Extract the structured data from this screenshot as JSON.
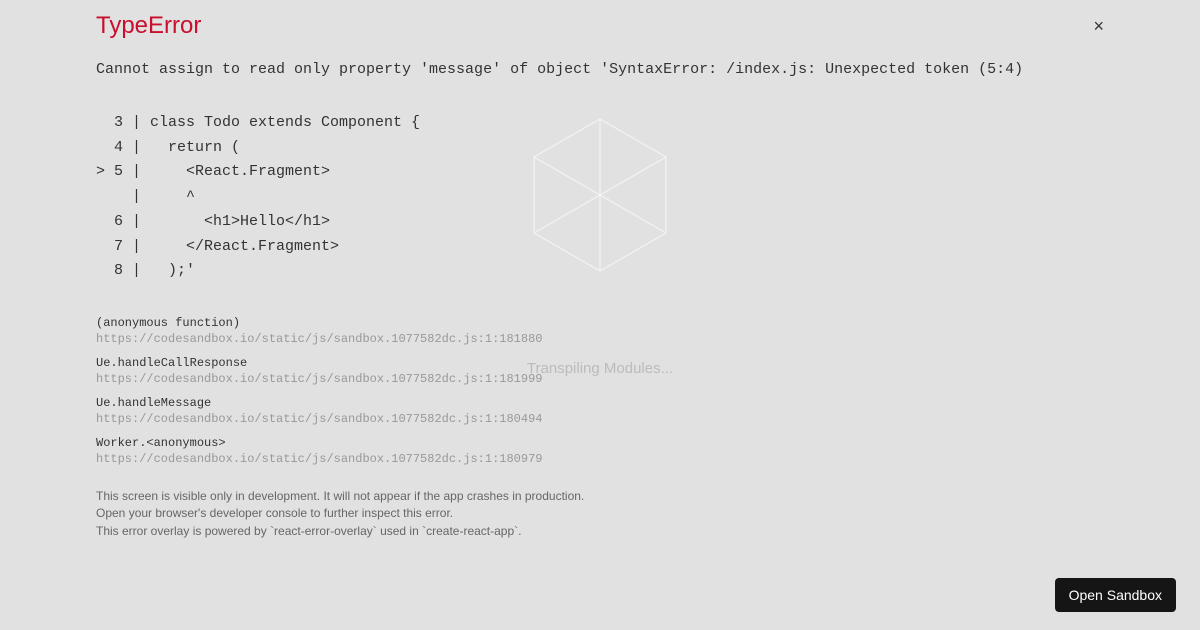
{
  "error": {
    "type": "TypeError",
    "message": "Cannot assign to read only property 'message' of object 'SyntaxError: /index.js: Unexpected token (5:4)",
    "codeFrame": "  3 | class Todo extends Component {\n  4 |   return (\n> 5 |     <React.Fragment>\n    |     ^\n  6 |       <h1>Hello</h1>\n  7 |     </React.Fragment>\n  8 |   );'"
  },
  "stack": [
    {
      "fn": "(anonymous function)",
      "loc": "https://codesandbox.io/static/js/sandbox.1077582dc.js:1:181880"
    },
    {
      "fn": "Ue.handleCallResponse",
      "loc": "https://codesandbox.io/static/js/sandbox.1077582dc.js:1:181999"
    },
    {
      "fn": "Ue.handleMessage",
      "loc": "https://codesandbox.io/static/js/sandbox.1077582dc.js:1:180494"
    },
    {
      "fn": "Worker.<anonymous>",
      "loc": "https://codesandbox.io/static/js/sandbox.1077582dc.js:1:180979"
    }
  ],
  "footer": {
    "line1": "This screen is visible only in development. It will not appear if the app crashes in production.",
    "line2": "Open your browser's developer console to further inspect this error.",
    "line3": "This error overlay is powered by `react-error-overlay` used in `create-react-app`."
  },
  "loading": {
    "text": "Transpiling Modules..."
  },
  "actions": {
    "openSandbox": "Open Sandbox",
    "close": "×"
  }
}
